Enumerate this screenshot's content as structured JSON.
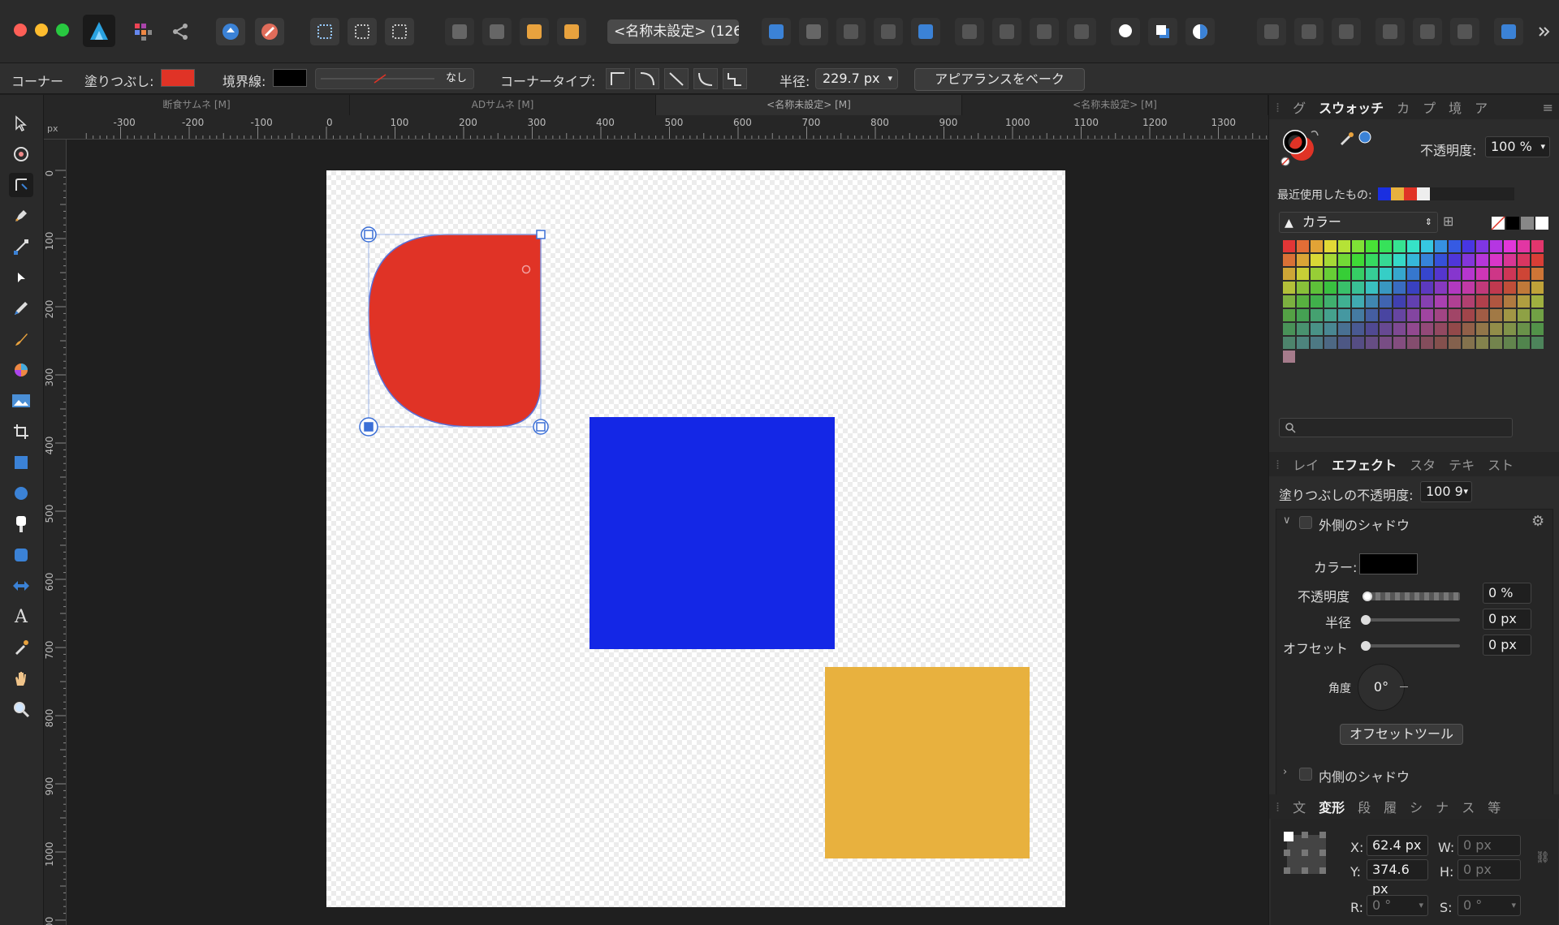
{
  "window": {
    "document_title": "<名称未設定> (126*"
  },
  "context_toolbar": {
    "corner_label": "コーナー",
    "fill_label": "塗りつぶし:",
    "fill_color": "#e03326",
    "stroke_label": "境界線:",
    "stroke_color": "#000000",
    "stroke_style": "なし",
    "corner_type_label": "コーナータイプ:",
    "radius_label": "半径:",
    "radius_value": "229.7 px",
    "bake_button": "アピアランスをベーク"
  },
  "doc_tabs": [
    "断食サムネ [M]",
    "ADサムネ [M]",
    "<名称未設定> [M]",
    "<名称未設定> [M]"
  ],
  "ruler": {
    "unit": "px",
    "h_ticks": [
      "-300",
      "-200",
      "-100",
      "0",
      "100",
      "200",
      "300",
      "400",
      "500",
      "600",
      "700",
      "800",
      "900",
      "1000",
      "1100",
      "1200",
      "1300"
    ],
    "v_ticks": [
      "0",
      "100",
      "200",
      "300",
      "400",
      "500",
      "600",
      "700",
      "800",
      "900",
      "1000",
      "00"
    ]
  },
  "canvas": {
    "shapes": [
      {
        "name": "red-rounded-shape",
        "color": "#e03326"
      },
      {
        "name": "blue-rectangle",
        "color": "#1427e6"
      },
      {
        "name": "yellow-rectangle",
        "color": "#e8b13e"
      }
    ]
  },
  "right_panel": {
    "top_tabs": [
      "グ",
      "スウォッチ",
      "カ",
      "プ",
      "境",
      "ア"
    ],
    "opacity_label": "不透明度:",
    "opacity_value": "100 %",
    "recent_label": "最近使用したもの:",
    "recent_colors": [
      "#1a2fe0",
      "#e8b13e",
      "#e03326",
      "#eeeeee"
    ],
    "palette_name": "カラー",
    "effects_tabs": [
      "レイ",
      "エフェクト",
      "スタ",
      "テキ",
      "スト"
    ],
    "fill_opacity_label": "塗りつぶしの不透明度:",
    "fill_opacity_value": "100 9",
    "outer_shadow_label": "外側のシャドウ",
    "color_label": "カラー:",
    "shadow_color": "#000000",
    "shadow_opacity_label": "不透明度",
    "shadow_opacity_value": "0 %",
    "shadow_radius_label": "半径",
    "shadow_radius_value": "0 px",
    "shadow_offset_label": "オフセット",
    "shadow_offset_value": "0 px",
    "angle_label": "角度",
    "angle_value": "0°",
    "offset_tool_button": "オフセットツール",
    "inner_shadow_label": "内側のシャドウ",
    "transform_tabs": [
      "文",
      "変形",
      "段",
      "履",
      "シ",
      "ナ",
      "ス",
      "等"
    ],
    "x_label": "X:",
    "x_value": "62.4 px",
    "y_label": "Y:",
    "y_value": "374.6 px",
    "w_label": "W:",
    "w_value": "0 px",
    "h_label": "H:",
    "h_value": "0 px",
    "r_label": "R:",
    "r_value": "0 °",
    "s_label": "S:",
    "s_value": "0 °"
  }
}
